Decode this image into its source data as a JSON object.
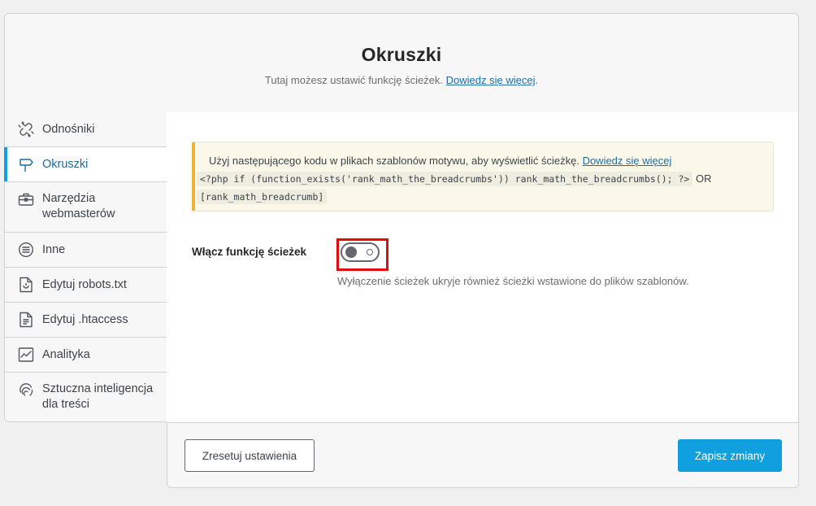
{
  "header": {
    "title": "Okruszki",
    "description": "Tutaj możesz ustawić funkcję ścieżek.",
    "learn_more": "Dowiedz się więcej",
    "period": "."
  },
  "sidebar": {
    "items": [
      {
        "label": "Odnośniki",
        "icon": "link-broken-icon",
        "active": false
      },
      {
        "label": "Okruszki",
        "icon": "signpost-icon",
        "active": true
      },
      {
        "label": "Narzędzia webmasterów",
        "icon": "toolbox-icon",
        "active": false
      },
      {
        "label": "Inne",
        "icon": "list-circle-icon",
        "active": false
      },
      {
        "label": "Edytuj robots.txt",
        "icon": "file-robot-icon",
        "active": false
      },
      {
        "label": "Edytuj .htaccess",
        "icon": "file-lines-icon",
        "active": false
      },
      {
        "label": "Analityka",
        "icon": "analytics-icon",
        "active": false
      },
      {
        "label": "Sztuczna inteligencja dla treści",
        "icon": "fingerprint-icon",
        "active": false
      }
    ]
  },
  "notice": {
    "text": "Użyj następującego kodu w plikach szablonów motywu, aby wyświetlić ścieżkę.",
    "link": "Dowiedz się więcej",
    "code_php": "<?php if (function_exists('rank_math_the_breadcrumbs')) rank_math_the_breadcrumbs(); ?>",
    "or_text": "OR",
    "code_shortcode": "[rank_math_breadcrumb]"
  },
  "field": {
    "label": "Włącz funkcję ścieżek",
    "enabled": false,
    "help": "Wyłączenie ścieżek ukryje również ścieżki wstawione do plików szablonów."
  },
  "footer": {
    "reset_label": "Zresetuj ustawienia",
    "save_label": "Zapisz zmiany"
  },
  "colors": {
    "accent": "#10a0e0",
    "notice_border": "#eeb43a",
    "highlight": "#e20b10"
  }
}
